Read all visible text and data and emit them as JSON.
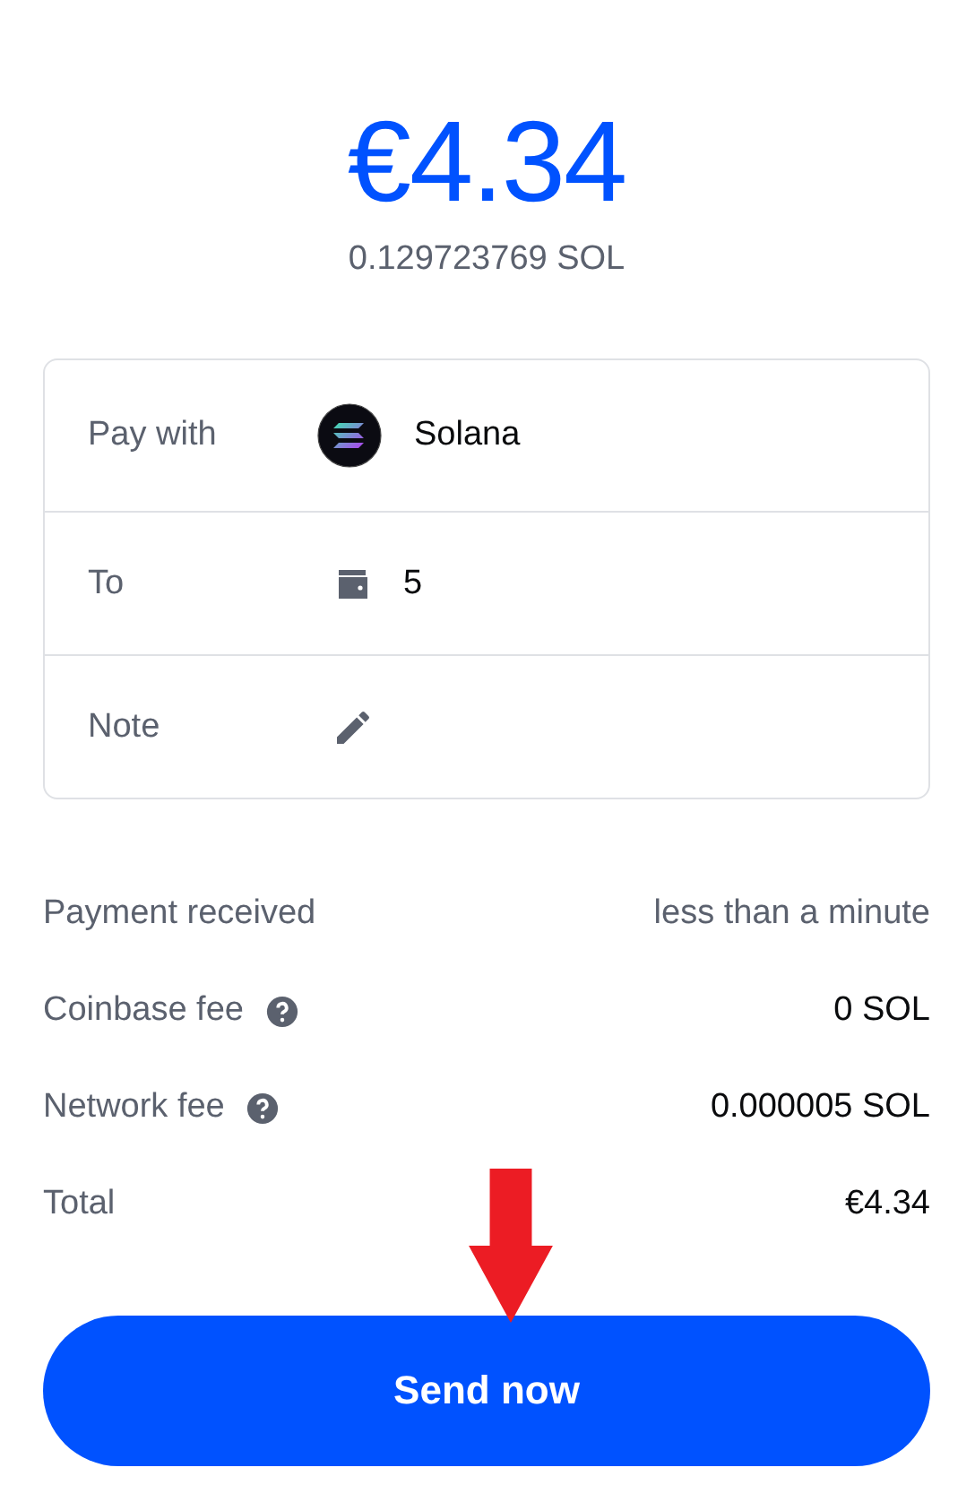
{
  "amount": {
    "fiat": "€4.34",
    "crypto": "0.129723769 SOL"
  },
  "details": [
    {
      "kind": "asset",
      "label": "Pay with",
      "value": "Solana"
    },
    {
      "kind": "address",
      "label": "To",
      "value": "5"
    },
    {
      "kind": "note",
      "label": "Note"
    }
  ],
  "summary": [
    {
      "label": "Payment received",
      "help": false,
      "value": "less than a minute",
      "muted": true
    },
    {
      "label": "Coinbase fee",
      "help": true,
      "value": "0 SOL",
      "muted": false
    },
    {
      "label": "Network fee",
      "help": true,
      "value": "0.000005 SOL",
      "muted": false
    },
    {
      "label": "Total",
      "help": false,
      "value": "€4.34",
      "muted": false
    }
  ],
  "send_button": "Send now"
}
